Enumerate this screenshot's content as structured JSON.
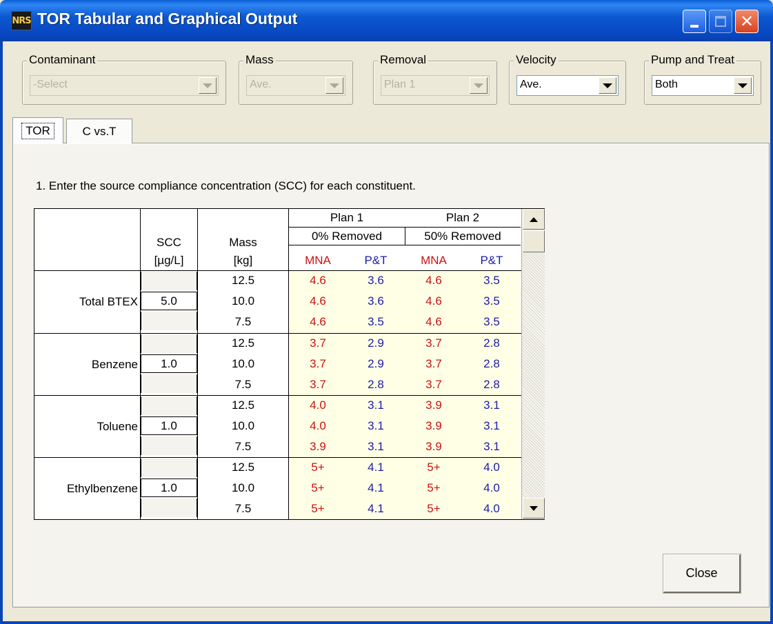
{
  "window": {
    "title": "TOR Tabular and Graphical Output",
    "icon_text": "NRS"
  },
  "controls": {
    "contaminant": {
      "label": "Contaminant",
      "value": "-Select"
    },
    "mass": {
      "label": "Mass",
      "value": "Ave."
    },
    "removal": {
      "label": "Removal",
      "value": "Plan 1"
    },
    "velocity": {
      "label": "Velocity",
      "value": "Ave."
    },
    "pump": {
      "label": "Pump and Treat",
      "value": "Both"
    }
  },
  "tabs": [
    {
      "label": "TOR"
    },
    {
      "label": "C vs.T"
    }
  ],
  "instruction": "1. Enter the source compliance concentration (SCC) for each constituent.",
  "grid": {
    "headers": {
      "scc": "SCC",
      "scc_unit": "[µg/L]",
      "mass": "Mass",
      "mass_unit": "[kg]",
      "plan1": "Plan 1",
      "plan2": "Plan 2",
      "plan1_removed": "0% Removed",
      "plan2_removed": "50% Removed",
      "mna": "MNA",
      "pt": "P&T"
    },
    "groups": [
      {
        "name": "Total BTEX",
        "scc": "5.0",
        "rows": [
          [
            "12.5",
            "4.6",
            "3.6",
            "4.6",
            "3.5"
          ],
          [
            "10.0",
            "4.6",
            "3.6",
            "4.6",
            "3.5"
          ],
          [
            "7.5",
            "4.6",
            "3.5",
            "4.6",
            "3.5"
          ]
        ]
      },
      {
        "name": "Benzene",
        "scc": "1.0",
        "rows": [
          [
            "12.5",
            "3.7",
            "2.9",
            "3.7",
            "2.8"
          ],
          [
            "10.0",
            "3.7",
            "2.9",
            "3.7",
            "2.8"
          ],
          [
            "7.5",
            "3.7",
            "2.8",
            "3.7",
            "2.8"
          ]
        ]
      },
      {
        "name": "Toluene",
        "scc": "1.0",
        "rows": [
          [
            "12.5",
            "4.0",
            "3.1",
            "3.9",
            "3.1"
          ],
          [
            "10.0",
            "4.0",
            "3.1",
            "3.9",
            "3.1"
          ],
          [
            "7.5",
            "3.9",
            "3.1",
            "3.9",
            "3.1"
          ]
        ]
      },
      {
        "name": "Ethylbenzene",
        "scc": "1.0",
        "rows": [
          [
            "12.5",
            "5+",
            "4.1",
            "5+",
            "4.0"
          ],
          [
            "10.0",
            "5+",
            "4.1",
            "5+",
            "4.0"
          ],
          [
            "7.5",
            "5+",
            "4.1",
            "5+",
            "4.0"
          ]
        ]
      }
    ]
  },
  "buttons": {
    "close": "Close"
  }
}
